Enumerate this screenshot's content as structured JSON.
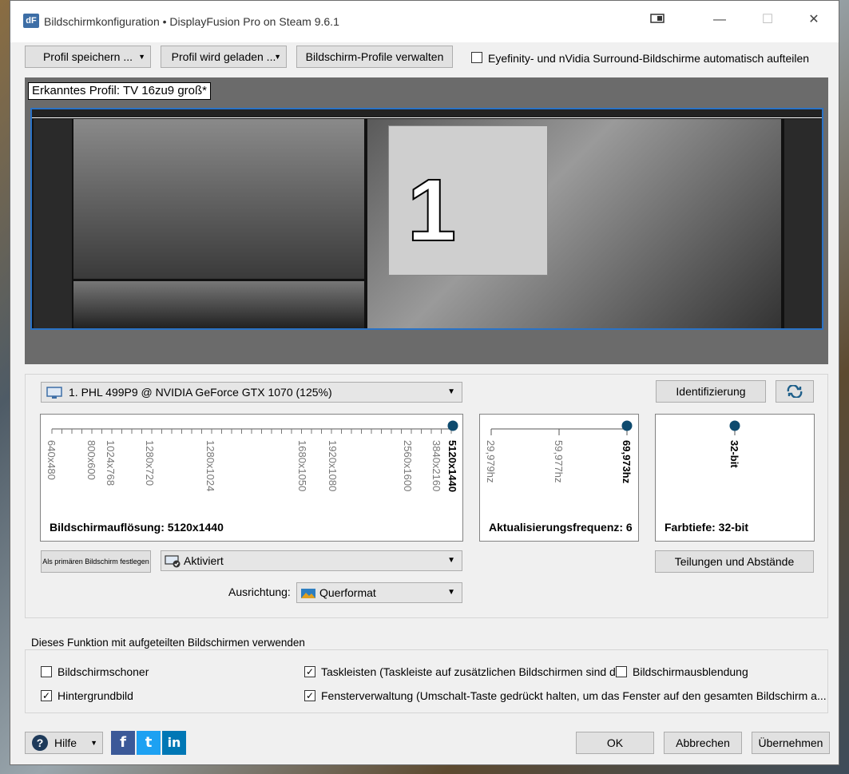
{
  "window": {
    "title": "Bildschirmkonfiguration • DisplayFusion Pro on Steam 9.6.1",
    "icon_label": "dF"
  },
  "toolbar": {
    "save_profile": "Profil speichern ...",
    "loading_profile": "Profil wird geladen ...",
    "manage_profiles": "Bildschirm-Profile verwalten",
    "eyefinity_label": "Eyefinity- und nVidia Surround-Bildschirme automatisch aufteilen",
    "eyefinity_checked": false
  },
  "preview": {
    "detected_profile": "Erkanntes Profil: TV 16zu9 groß*",
    "monitor_number": "1"
  },
  "monitor": {
    "selected": "1. PHL 499P9 @ NVIDIA GeForce GTX 1070 (125%)",
    "identify": "Identifizierung"
  },
  "resolution": {
    "ticks": [
      "640x480",
      "800x600",
      "1024x768",
      "1280x720",
      "1280x1024",
      "1680x1050",
      "1920x1080",
      "2560x1600",
      "3840x2160",
      "5120x1440"
    ],
    "selected": "5120x1440",
    "label": "Bildschirmauflösung: 5120x1440"
  },
  "refresh": {
    "ticks": [
      "29,979hz",
      "59,977hz",
      "69,973hz"
    ],
    "selected": "69,973hz",
    "label": "Aktualisierungsfrequenz: 6"
  },
  "depth": {
    "ticks": [
      "32-bit"
    ],
    "selected": "32-bit",
    "label": "Farbtiefe: 32-bit"
  },
  "controls": {
    "set_primary": "Als primären Bildschirm festlegen",
    "status": "Aktiviert",
    "orientation_label": "Ausrichtung:",
    "orientation": "Querformat",
    "splits": "Teilungen und Abstände"
  },
  "split_features": {
    "heading": "Dieses Funktion mit aufgeteilten Bildschirmen verwenden",
    "screensaver": {
      "label": "Bildschirmschoner",
      "checked": false
    },
    "wallpaper": {
      "label": "Hintergrundbild",
      "checked": true
    },
    "taskbars": {
      "label": "Taskleisten (Taskleiste auf zusätzlichen Bildschirmen sind d...",
      "checked": true
    },
    "fading": {
      "label": "Bildschirmausblendung",
      "checked": false
    },
    "windowmgmt": {
      "label": "Fensterverwaltung (Umschalt-Taste gedrückt halten, um das Fenster auf den gesamten Bildschirm a...",
      "checked": true
    }
  },
  "footer": {
    "help": "Hilfe",
    "ok": "OK",
    "cancel": "Abbrechen",
    "apply": "Übernehmen"
  },
  "social": {
    "facebook": "f",
    "twitter": "t",
    "linkedin": "in"
  },
  "colors": {
    "accent": "#0e4a6e",
    "monitor_border": "#2a73c7"
  }
}
